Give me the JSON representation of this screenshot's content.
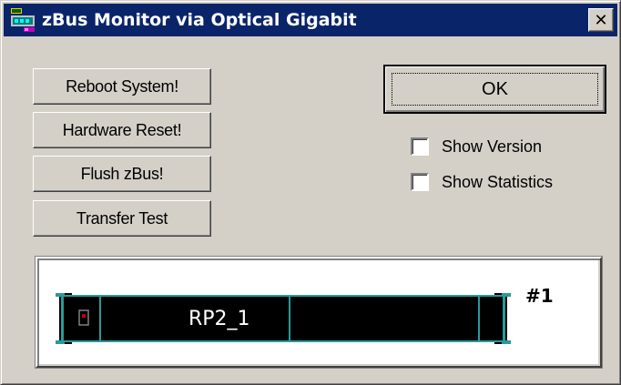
{
  "window": {
    "title": "zBus Monitor via Optical Gigabit",
    "close_label": "✕"
  },
  "buttons": {
    "reboot": "Reboot System!",
    "hardware_reset": "Hardware Reset!",
    "flush": "Flush zBus!",
    "transfer_test": "Transfer Test",
    "ok": "OK"
  },
  "options": {
    "show_version": {
      "label": "Show Version",
      "checked": false
    },
    "show_statistics": {
      "label": "Show Statistics",
      "checked": false
    }
  },
  "device": {
    "name": "RP2_1",
    "number": "#1"
  },
  "colors": {
    "titlebar": "#0a246a",
    "face": "#d4d0c8",
    "device_body": "#000000",
    "device_lines": "#2a9a9a",
    "indicator": "#c00000"
  }
}
